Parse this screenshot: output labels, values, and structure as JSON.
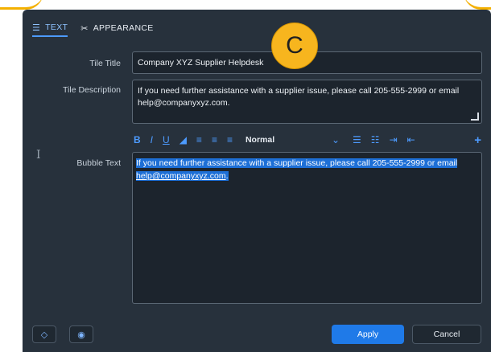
{
  "tabs": [
    {
      "label": "TEXT",
      "icon": "text-lines-icon",
      "active": true
    },
    {
      "label": "APPEARANCE",
      "icon": "tools-icon",
      "active": false
    }
  ],
  "badge": {
    "letter": "C",
    "color": "#f7b51e"
  },
  "form": {
    "tile_title_label": "Tile Title",
    "tile_title_value": "Company XYZ Supplier Helpdesk",
    "tile_description_label": "Tile Description",
    "tile_description_value": "If you need further assistance with a supplier issue, please call 205-555-2999 or email help@companyxyz.com.",
    "bubble_text_label": "Bubble Text",
    "bubble_text_part1": "If you need further assistance with a supplier issue, please call 205-555-2999 or email ",
    "bubble_text_link": "help@companyxyz.com",
    "bubble_text_end": "."
  },
  "toolbar": {
    "bold": "B",
    "italic": "I",
    "underline": "U",
    "paragraph_style": "Normal"
  },
  "buttons": {
    "apply": "Apply",
    "cancel": "Cancel"
  },
  "colors": {
    "panel": "#27313c",
    "accent": "#4d9bff",
    "primary_button": "#1f7ae8",
    "selection": "#1d6fd6"
  }
}
